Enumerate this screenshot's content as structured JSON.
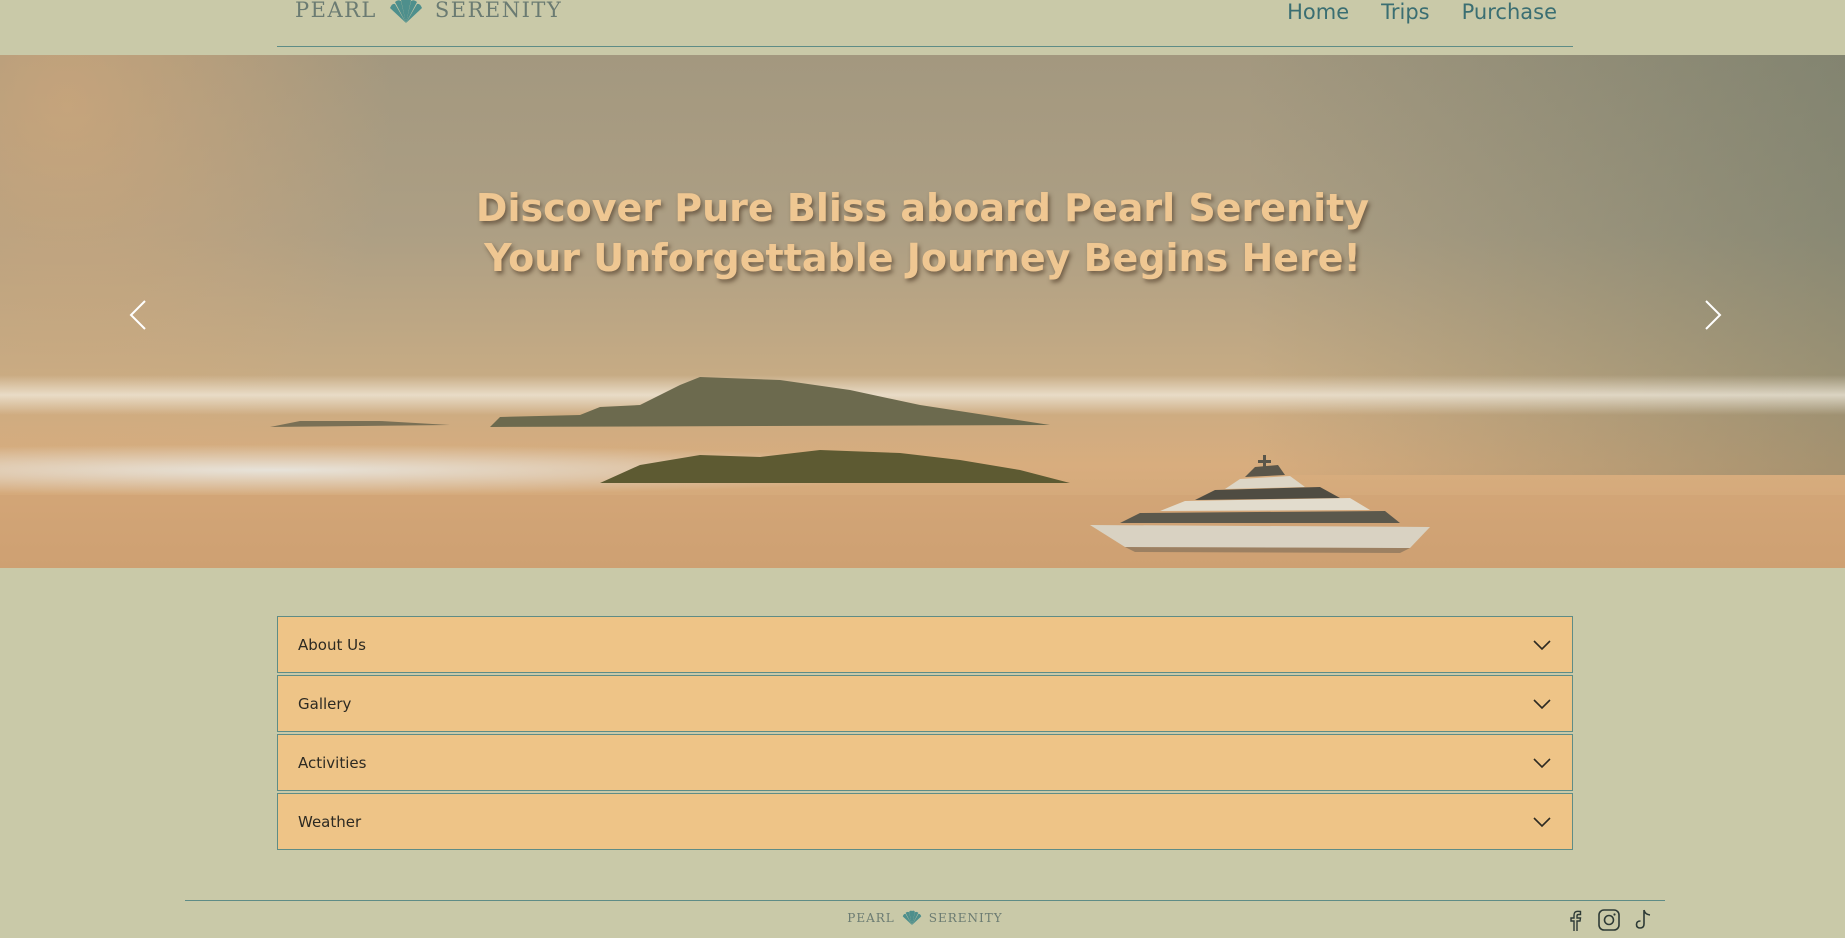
{
  "brand": {
    "word1": "PEARL",
    "word2": "SERENITY"
  },
  "nav": {
    "items": [
      {
        "label": "Home"
      },
      {
        "label": "Trips"
      },
      {
        "label": "Purchase"
      }
    ]
  },
  "hero": {
    "line1": "Discover Pure Bliss aboard Pearl Serenity",
    "line2": "Your Unforgettable Journey Begins Here!"
  },
  "accordion": {
    "items": [
      {
        "label": "About Us"
      },
      {
        "label": "Gallery"
      },
      {
        "label": "Activities"
      },
      {
        "label": "Weather"
      }
    ]
  },
  "footer": {
    "brand": {
      "word1": "PEARL",
      "word2": "SERENITY"
    },
    "social": [
      {
        "icon": "facebook-icon"
      },
      {
        "icon": "instagram-icon"
      },
      {
        "icon": "tiktok-icon"
      }
    ]
  },
  "colors": {
    "background": "#c9c9a8",
    "accent": "#3a6e72",
    "accordion_bg": "#eec487",
    "hero_text": "#efc792"
  }
}
